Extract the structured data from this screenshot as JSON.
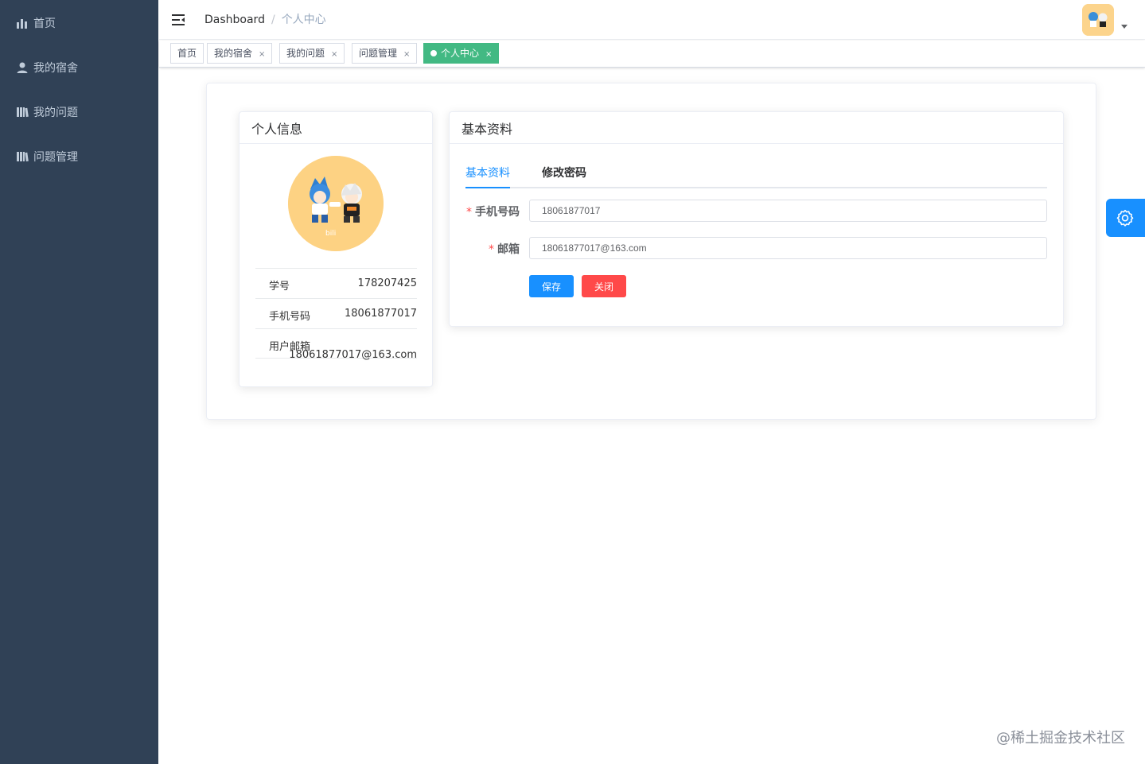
{
  "colors": {
    "sidebar_bg": "#304156",
    "sidebar_text": "#bfcbd9",
    "primary": "#1890ff",
    "danger": "#ff4949",
    "tag_active": "#42b983"
  },
  "sidebar": {
    "items": [
      {
        "label": "首页",
        "icon": "bar-chart-icon"
      },
      {
        "label": "我的宿舍",
        "icon": "user-icon"
      },
      {
        "label": "我的问题",
        "icon": "book-icon"
      },
      {
        "label": "问题管理",
        "icon": "book-icon"
      }
    ]
  },
  "navbar": {
    "breadcrumb": [
      "Dashboard",
      "个人中心"
    ],
    "separator": "/"
  },
  "tags": [
    {
      "label": "首页",
      "closable": false,
      "active": false
    },
    {
      "label": "我的宿舍",
      "closable": true,
      "active": false
    },
    {
      "label": "我的问题",
      "closable": true,
      "active": false
    },
    {
      "label": "问题管理",
      "closable": true,
      "active": false
    },
    {
      "label": "个人中心",
      "closable": true,
      "active": true
    }
  ],
  "tag_close_glyph": "×",
  "profile_card": {
    "title": "个人信息",
    "rows": [
      {
        "label": "学号",
        "value": "178207425"
      },
      {
        "label": "手机号码",
        "value": "18061877017"
      },
      {
        "label": "用户邮箱",
        "value": "18061877017@163.com"
      }
    ]
  },
  "form_card": {
    "title": "基本资料",
    "tabs": [
      "基本资料",
      "修改密码"
    ],
    "fields": [
      {
        "label": "手机号码",
        "value": "18061877017",
        "required": "*"
      },
      {
        "label": "邮箱",
        "value": "18061877017@163.com",
        "required": "*"
      }
    ],
    "save_label": "保存",
    "close_label": "关闭"
  },
  "watermark": "@稀土掘金技术社区"
}
